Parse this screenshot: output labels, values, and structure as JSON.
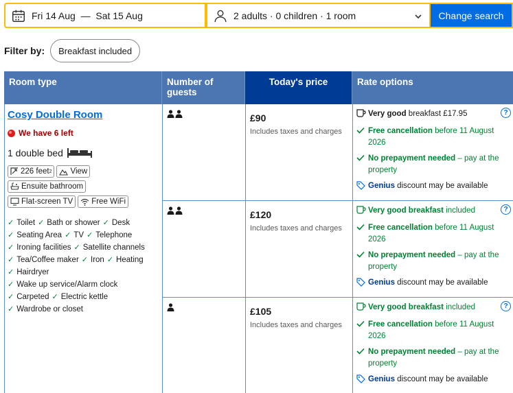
{
  "search": {
    "dates": "Fri 14 Aug  —  Sat 15 Aug",
    "guests": "2 adults · 0 children · 1 room",
    "button": "Change search"
  },
  "filter": {
    "label": "Filter by:",
    "chip": "Breakfast included"
  },
  "table": {
    "headers": [
      "Room type",
      "Number of guests",
      "Today's price",
      "Rate options"
    ],
    "room": {
      "name": "Cosy Double Room",
      "availability": "We have 6 left",
      "bed": "1 double bed",
      "size": "226 feet",
      "size_unit_sup": "2",
      "tags": [
        "View",
        "Ensuite bathroom",
        "Flat-screen TV",
        "Free WiFi"
      ],
      "amenities": [
        "Toilet",
        "Bath or shower",
        "Desk",
        "Seating Area",
        "TV",
        "Telephone",
        "Ironing facilities",
        "Satellite channels",
        "Tea/Coffee maker",
        "Iron",
        "Heating",
        "Hairdryer",
        "Wake up service/Alarm clock",
        "Carpeted",
        "Electric kettle",
        "Wardrobe or closet"
      ]
    },
    "rows": [
      {
        "guests": 2,
        "price": "£90",
        "price_note": "Includes taxes and charges",
        "breakfast_bold": "Very good",
        "breakfast_rest": " breakfast £17.95",
        "cancel_bold": "Free cancellation",
        "cancel_rest": " before 11 August 2026",
        "prepay_bold": "No prepayment needed",
        "prepay_rest": " – pay at the property",
        "genius_bold": "Genius",
        "genius_rest": " discount may be available"
      },
      {
        "guests": 2,
        "price": "£120",
        "price_note": "Includes taxes and charges",
        "breakfast_bold": "Very good breakfast",
        "breakfast_rest": " included",
        "cancel_bold": "Free cancellation",
        "cancel_rest": " before 11 August 2026",
        "prepay_bold": "No prepayment needed",
        "prepay_rest": " – pay at the property",
        "genius_bold": "Genius",
        "genius_rest": " discount may be available"
      },
      {
        "guests": 1,
        "price": "£105",
        "price_note": "Includes taxes and charges",
        "breakfast_bold": "Very good breakfast",
        "breakfast_rest": " included",
        "cancel_bold": "Free cancellation",
        "cancel_rest": " before 11 August 2026",
        "prepay_bold": "No prepayment needed",
        "prepay_rest": " – pay at the property",
        "genius_bold": "Genius",
        "genius_rest": " discount may be available"
      }
    ]
  },
  "colors": {
    "header_blue": "#4c76b2",
    "price_header": "#003b95",
    "brand_blue": "#006ce4",
    "green": "#008234",
    "yellow": "#febb02"
  }
}
